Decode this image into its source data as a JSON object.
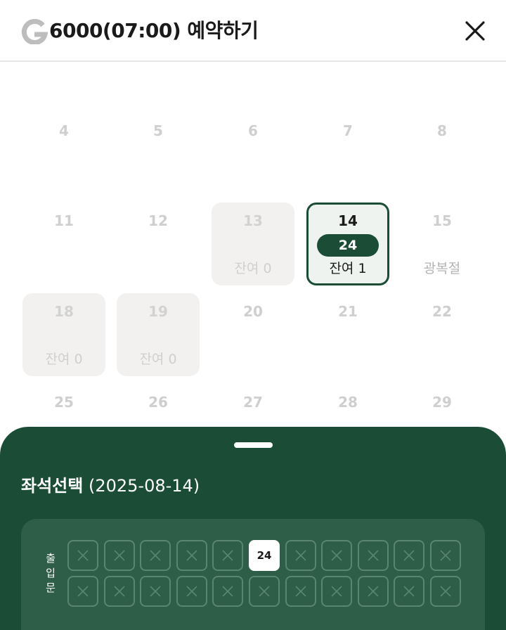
{
  "header": {
    "title": "6000(07:00) 예약하기",
    "logo_icon": "g-logo-icon",
    "close_icon": "close-icon"
  },
  "calendar": {
    "days": [
      {
        "num": "4",
        "sub": "",
        "state": "past"
      },
      {
        "num": "5",
        "sub": "",
        "state": "past"
      },
      {
        "num": "6",
        "sub": "",
        "state": "past"
      },
      {
        "num": "7",
        "sub": "",
        "state": "past"
      },
      {
        "num": "8",
        "sub": "",
        "state": "past"
      },
      {
        "num": "11",
        "sub": "",
        "state": "past"
      },
      {
        "num": "12",
        "sub": "",
        "state": "past"
      },
      {
        "num": "13",
        "sub": "잔여 0",
        "state": "full"
      },
      {
        "num": "14",
        "sub": "잔여 1",
        "state": "selected",
        "badge": "24"
      },
      {
        "num": "15",
        "sub": "광복절",
        "state": "holiday"
      },
      {
        "num": "18",
        "sub": "잔여 0",
        "state": "full"
      },
      {
        "num": "19",
        "sub": "잔여 0",
        "state": "full"
      },
      {
        "num": "20",
        "sub": "",
        "state": "past"
      },
      {
        "num": "21",
        "sub": "",
        "state": "past"
      },
      {
        "num": "22",
        "sub": "",
        "state": "past"
      },
      {
        "num": "25",
        "sub": "",
        "state": "past"
      },
      {
        "num": "26",
        "sub": "",
        "state": "past"
      },
      {
        "num": "27",
        "sub": "",
        "state": "past"
      },
      {
        "num": "28",
        "sub": "",
        "state": "past"
      },
      {
        "num": "29",
        "sub": "",
        "state": "past"
      }
    ]
  },
  "sheet": {
    "title_bold": "좌석선택",
    "title_date": "(2025-08-14)",
    "entrance_label": [
      "출",
      "입",
      "문"
    ],
    "available_seat_label": "24",
    "seat_rows": [
      [
        "x",
        "x",
        "x",
        "x",
        "x",
        "24",
        "x",
        "x",
        "x",
        "x",
        "x"
      ],
      [
        "x",
        "x",
        "x",
        "x",
        "x",
        "x",
        "x",
        "x",
        "x",
        "x",
        "x"
      ]
    ]
  },
  "colors": {
    "brand_green": "#1b4d36",
    "seatmap_bg": "#2e5e48",
    "full_bg": "#f2f1ef"
  }
}
